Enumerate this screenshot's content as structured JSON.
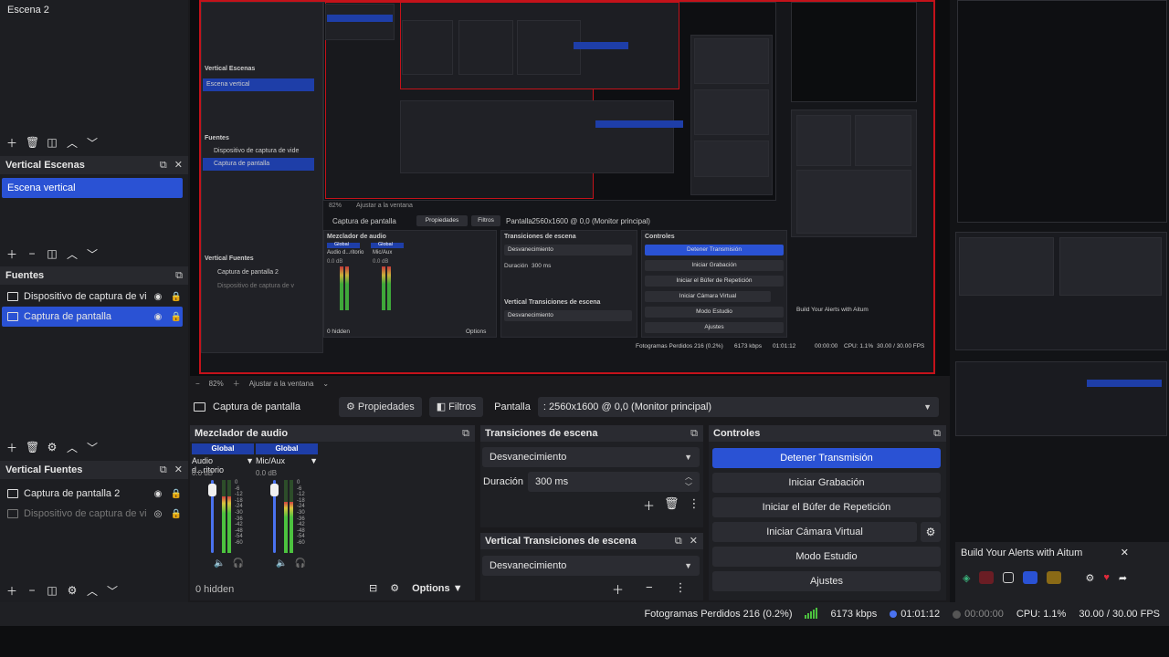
{
  "scenes": {
    "items": [
      "Escena 2"
    ]
  },
  "vertical_scenes": {
    "title": "Vertical Escenas",
    "items": [
      "Escena vertical"
    ]
  },
  "sources": {
    "title": "Fuentes",
    "items": [
      {
        "name": "Dispositivo de captura de video",
        "selected": false
      },
      {
        "name": "Captura de pantalla",
        "selected": true
      }
    ]
  },
  "vertical_sources": {
    "title": "Vertical Fuentes",
    "items": [
      {
        "name": "Captura de pantalla 2",
        "dim": false
      },
      {
        "name": "Dispositivo de captura de video",
        "dim": true
      }
    ]
  },
  "zoom": {
    "value": "82%",
    "fit_label": "Ajustar a la ventana"
  },
  "source_bar": {
    "source_name": "Captura de pantalla",
    "properties": "Propiedades",
    "filters": "Filtros",
    "display_label": "Pantalla",
    "display_value": ": 2560x1600 @ 0,0 (Monitor principal)"
  },
  "mixer": {
    "title": "Mezclador de audio",
    "channels": [
      {
        "label": "Global",
        "device": "Audio d...ritorio",
        "db": "0.0 dB"
      },
      {
        "label": "Global",
        "device": "Mic/Aux",
        "db": "0.0 dB"
      }
    ],
    "scale": [
      "0",
      "-6",
      "-12",
      "-18",
      "-24",
      "-30",
      "-36",
      "-42",
      "-48",
      "-54",
      "-60"
    ],
    "hidden": "0 hidden",
    "options": "Options"
  },
  "transitions": {
    "title": "Transiciones de escena",
    "current": "Desvanecimiento",
    "duration_label": "Duración",
    "duration_value": "300 ms"
  },
  "vertical_transitions": {
    "title": "Vertical Transiciones de escena",
    "current": "Desvanecimiento"
  },
  "controls": {
    "title": "Controles",
    "stop_stream": "Detener Transmisión",
    "start_recording": "Iniciar Grabación",
    "start_replay": "Iniciar el Búfer de Repetición",
    "start_virtualcam": "Iniciar Cámara Virtual",
    "studio_mode": "Modo Estudio",
    "settings": "Ajustes"
  },
  "alerts": {
    "title": "Build Your Alerts with Aitum"
  },
  "status": {
    "dropped": "Fotogramas Perdidos 216 (0.2%)",
    "bitrate": "6173 kbps",
    "stream_time": "01:01:12",
    "rec_time": "00:00:00",
    "cpu": "CPU: 1.1%",
    "fps": "30.00 / 30.00 FPS"
  },
  "nested": {
    "vertical_scene_title": "Vertical Escenas",
    "vertical_scene_item": "Escena vertical",
    "sources_title": "Fuentes",
    "source_1": "Dispositivo de captura de vide",
    "source_2": "Captura de pantalla",
    "vsources_title": "Vertical Fuentes",
    "vsource_1": "Captura de pantalla 2",
    "vsource_2": "Dispositivo de captura de v",
    "zoom": "82%",
    "fit": "Ajustar a la ventana",
    "src_name": "Captura de pantalla",
    "props": "Propiedades",
    "filters": "Filtros",
    "display_label": "Pantalla",
    "display_value": ": 2560x1600 @ 0,0 (Monitor principal)",
    "mixer": "Mezclador de audio",
    "global": "Global",
    "ch1": "Audio d...ritorio",
    "ch2": "Mic/Aux",
    "db": "0.0 dB",
    "hidden": "0 hidden",
    "options": "Options",
    "trans": "Transiciones de escena",
    "fade": "Desvanecimiento",
    "dur": "Duración",
    "dur_v": "300 ms",
    "vtrans": "Vertical Transiciones de escena",
    "controls": "Controles",
    "stop": "Detener Transmisión",
    "rec": "Iniciar Grabación",
    "replay": "Iniciar el Búfer de Repetición",
    "vcam": "Iniciar Cámara Virtual",
    "studio": "Modo Estudio",
    "settings": "Ajustes",
    "alerts": "Build Your Alerts with Aitum",
    "status": "Fotogramas Perdidos 216 (0.2%)",
    "kbps": "6173 kbps",
    "time": "01:01:12",
    "rec_time": "00:00:00",
    "cpu": "CPU: 1.1%",
    "fps": "30.00 / 30.00 FPS"
  },
  "colors": {
    "accent": "#2a52d4",
    "record_border": "#c4121a",
    "meter_green": "#4cc23f"
  }
}
